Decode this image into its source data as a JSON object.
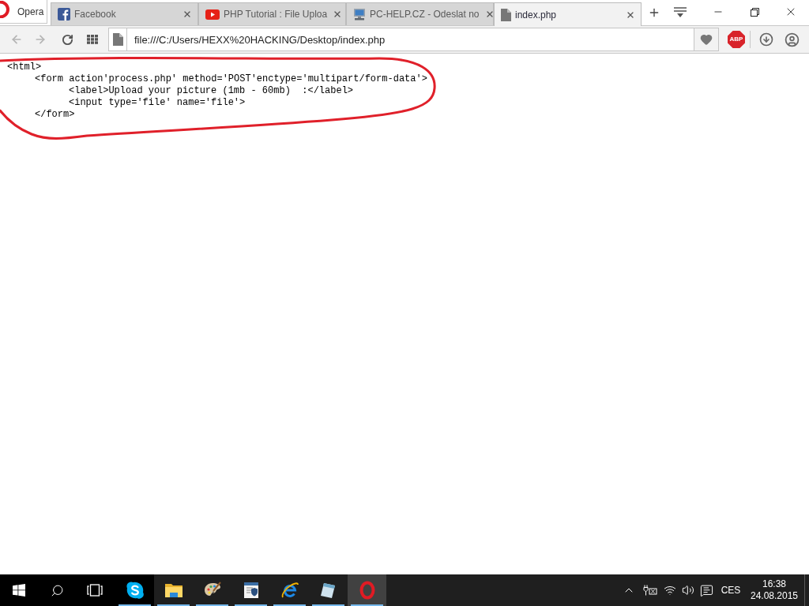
{
  "browser": {
    "menu_button": {
      "label": "Opera"
    },
    "tabs": [
      {
        "title": "Facebook",
        "selected": false
      },
      {
        "title": "PHP Tutorial : File Uploa",
        "selected": false
      },
      {
        "title": "PC-HELP.CZ - Odeslat no",
        "selected": false
      },
      {
        "title": "index.php",
        "selected": true
      }
    ],
    "toolbar": {
      "back": {
        "disabled": true
      },
      "forward": {
        "disabled": true
      },
      "address": {
        "value": "file:///C:/Users/HEXX%20HACKING/Desktop/index.php"
      },
      "extension_badge": "ABP"
    }
  },
  "page": {
    "code_lines": [
      {
        "text": "<html>",
        "children": [
          {
            "text": "<form action'process.php' method='POST'enctype='multipart/form-data'>",
            "children": [
              {
                "text": "<label>Upload your picture (1mb - 60mb)  :</label>"
              },
              {
                "text": "<input type='file' name='file'>"
              }
            ]
          },
          {
            "text": "</form>"
          }
        ]
      }
    ]
  },
  "taskbar": {
    "apps": [
      {
        "running": true,
        "selected": false
      },
      {
        "running": true,
        "selected": false
      },
      {
        "running": true,
        "selected": false
      },
      {
        "running": true,
        "selected": false
      },
      {
        "running": true,
        "selected": false
      },
      {
        "running": true,
        "selected": false
      },
      {
        "running": true,
        "selected": true
      }
    ],
    "tray": {
      "language": "CES",
      "time": "16:38",
      "date": "24.08.2015"
    }
  }
}
